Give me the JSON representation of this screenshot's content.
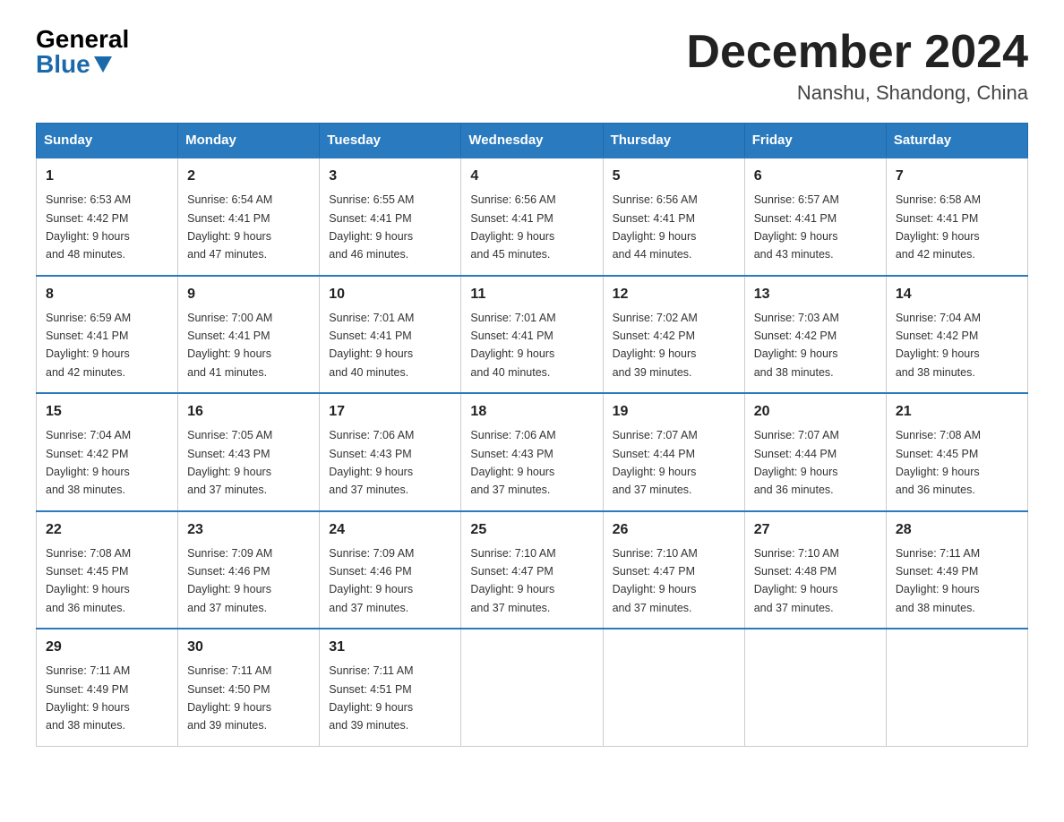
{
  "header": {
    "logo_general": "General",
    "logo_blue": "Blue",
    "month_year": "December 2024",
    "location": "Nanshu, Shandong, China"
  },
  "weekdays": [
    "Sunday",
    "Monday",
    "Tuesday",
    "Wednesday",
    "Thursday",
    "Friday",
    "Saturday"
  ],
  "weeks": [
    [
      {
        "day": "1",
        "sunrise": "6:53 AM",
        "sunset": "4:42 PM",
        "daylight": "9 hours and 48 minutes."
      },
      {
        "day": "2",
        "sunrise": "6:54 AM",
        "sunset": "4:41 PM",
        "daylight": "9 hours and 47 minutes."
      },
      {
        "day": "3",
        "sunrise": "6:55 AM",
        "sunset": "4:41 PM",
        "daylight": "9 hours and 46 minutes."
      },
      {
        "day": "4",
        "sunrise": "6:56 AM",
        "sunset": "4:41 PM",
        "daylight": "9 hours and 45 minutes."
      },
      {
        "day": "5",
        "sunrise": "6:56 AM",
        "sunset": "4:41 PM",
        "daylight": "9 hours and 44 minutes."
      },
      {
        "day": "6",
        "sunrise": "6:57 AM",
        "sunset": "4:41 PM",
        "daylight": "9 hours and 43 minutes."
      },
      {
        "day": "7",
        "sunrise": "6:58 AM",
        "sunset": "4:41 PM",
        "daylight": "9 hours and 42 minutes."
      }
    ],
    [
      {
        "day": "8",
        "sunrise": "6:59 AM",
        "sunset": "4:41 PM",
        "daylight": "9 hours and 42 minutes."
      },
      {
        "day": "9",
        "sunrise": "7:00 AM",
        "sunset": "4:41 PM",
        "daylight": "9 hours and 41 minutes."
      },
      {
        "day": "10",
        "sunrise": "7:01 AM",
        "sunset": "4:41 PM",
        "daylight": "9 hours and 40 minutes."
      },
      {
        "day": "11",
        "sunrise": "7:01 AM",
        "sunset": "4:41 PM",
        "daylight": "9 hours and 40 minutes."
      },
      {
        "day": "12",
        "sunrise": "7:02 AM",
        "sunset": "4:42 PM",
        "daylight": "9 hours and 39 minutes."
      },
      {
        "day": "13",
        "sunrise": "7:03 AM",
        "sunset": "4:42 PM",
        "daylight": "9 hours and 38 minutes."
      },
      {
        "day": "14",
        "sunrise": "7:04 AM",
        "sunset": "4:42 PM",
        "daylight": "9 hours and 38 minutes."
      }
    ],
    [
      {
        "day": "15",
        "sunrise": "7:04 AM",
        "sunset": "4:42 PM",
        "daylight": "9 hours and 38 minutes."
      },
      {
        "day": "16",
        "sunrise": "7:05 AM",
        "sunset": "4:43 PM",
        "daylight": "9 hours and 37 minutes."
      },
      {
        "day": "17",
        "sunrise": "7:06 AM",
        "sunset": "4:43 PM",
        "daylight": "9 hours and 37 minutes."
      },
      {
        "day": "18",
        "sunrise": "7:06 AM",
        "sunset": "4:43 PM",
        "daylight": "9 hours and 37 minutes."
      },
      {
        "day": "19",
        "sunrise": "7:07 AM",
        "sunset": "4:44 PM",
        "daylight": "9 hours and 37 minutes."
      },
      {
        "day": "20",
        "sunrise": "7:07 AM",
        "sunset": "4:44 PM",
        "daylight": "9 hours and 36 minutes."
      },
      {
        "day": "21",
        "sunrise": "7:08 AM",
        "sunset": "4:45 PM",
        "daylight": "9 hours and 36 minutes."
      }
    ],
    [
      {
        "day": "22",
        "sunrise": "7:08 AM",
        "sunset": "4:45 PM",
        "daylight": "9 hours and 36 minutes."
      },
      {
        "day": "23",
        "sunrise": "7:09 AM",
        "sunset": "4:46 PM",
        "daylight": "9 hours and 37 minutes."
      },
      {
        "day": "24",
        "sunrise": "7:09 AM",
        "sunset": "4:46 PM",
        "daylight": "9 hours and 37 minutes."
      },
      {
        "day": "25",
        "sunrise": "7:10 AM",
        "sunset": "4:47 PM",
        "daylight": "9 hours and 37 minutes."
      },
      {
        "day": "26",
        "sunrise": "7:10 AM",
        "sunset": "4:47 PM",
        "daylight": "9 hours and 37 minutes."
      },
      {
        "day": "27",
        "sunrise": "7:10 AM",
        "sunset": "4:48 PM",
        "daylight": "9 hours and 37 minutes."
      },
      {
        "day": "28",
        "sunrise": "7:11 AM",
        "sunset": "4:49 PM",
        "daylight": "9 hours and 38 minutes."
      }
    ],
    [
      {
        "day": "29",
        "sunrise": "7:11 AM",
        "sunset": "4:49 PM",
        "daylight": "9 hours and 38 minutes."
      },
      {
        "day": "30",
        "sunrise": "7:11 AM",
        "sunset": "4:50 PM",
        "daylight": "9 hours and 39 minutes."
      },
      {
        "day": "31",
        "sunrise": "7:11 AM",
        "sunset": "4:51 PM",
        "daylight": "9 hours and 39 minutes."
      },
      null,
      null,
      null,
      null
    ]
  ],
  "labels": {
    "sunrise": "Sunrise:",
    "sunset": "Sunset:",
    "daylight": "Daylight:"
  }
}
